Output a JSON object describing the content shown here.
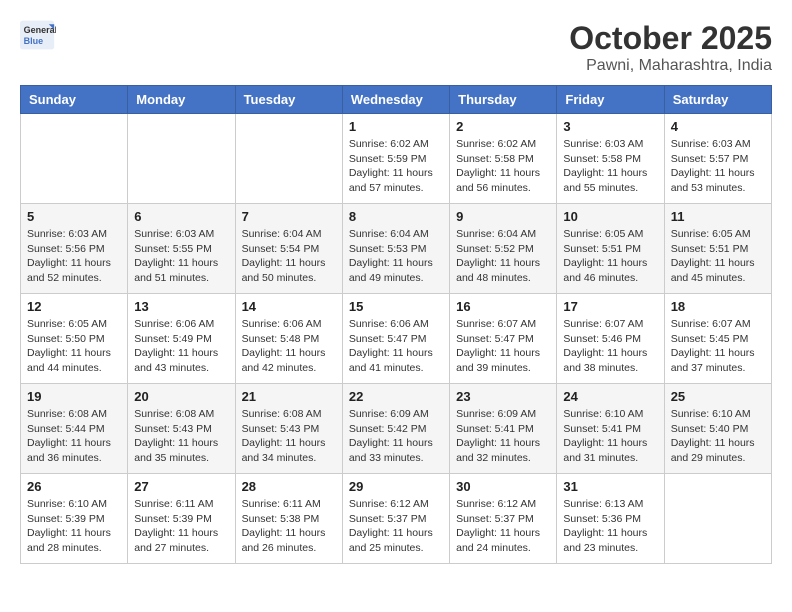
{
  "header": {
    "logo_line1": "General",
    "logo_line2": "Blue",
    "title": "October 2025",
    "subtitle": "Pawni, Maharashtra, India"
  },
  "days_of_week": [
    "Sunday",
    "Monday",
    "Tuesday",
    "Wednesday",
    "Thursday",
    "Friday",
    "Saturday"
  ],
  "weeks": [
    [
      {
        "day": "",
        "info": ""
      },
      {
        "day": "",
        "info": ""
      },
      {
        "day": "",
        "info": ""
      },
      {
        "day": "1",
        "info": "Sunrise: 6:02 AM\nSunset: 5:59 PM\nDaylight: 11 hours\nand 57 minutes."
      },
      {
        "day": "2",
        "info": "Sunrise: 6:02 AM\nSunset: 5:58 PM\nDaylight: 11 hours\nand 56 minutes."
      },
      {
        "day": "3",
        "info": "Sunrise: 6:03 AM\nSunset: 5:58 PM\nDaylight: 11 hours\nand 55 minutes."
      },
      {
        "day": "4",
        "info": "Sunrise: 6:03 AM\nSunset: 5:57 PM\nDaylight: 11 hours\nand 53 minutes."
      }
    ],
    [
      {
        "day": "5",
        "info": "Sunrise: 6:03 AM\nSunset: 5:56 PM\nDaylight: 11 hours\nand 52 minutes."
      },
      {
        "day": "6",
        "info": "Sunrise: 6:03 AM\nSunset: 5:55 PM\nDaylight: 11 hours\nand 51 minutes."
      },
      {
        "day": "7",
        "info": "Sunrise: 6:04 AM\nSunset: 5:54 PM\nDaylight: 11 hours\nand 50 minutes."
      },
      {
        "day": "8",
        "info": "Sunrise: 6:04 AM\nSunset: 5:53 PM\nDaylight: 11 hours\nand 49 minutes."
      },
      {
        "day": "9",
        "info": "Sunrise: 6:04 AM\nSunset: 5:52 PM\nDaylight: 11 hours\nand 48 minutes."
      },
      {
        "day": "10",
        "info": "Sunrise: 6:05 AM\nSunset: 5:51 PM\nDaylight: 11 hours\nand 46 minutes."
      },
      {
        "day": "11",
        "info": "Sunrise: 6:05 AM\nSunset: 5:51 PM\nDaylight: 11 hours\nand 45 minutes."
      }
    ],
    [
      {
        "day": "12",
        "info": "Sunrise: 6:05 AM\nSunset: 5:50 PM\nDaylight: 11 hours\nand 44 minutes."
      },
      {
        "day": "13",
        "info": "Sunrise: 6:06 AM\nSunset: 5:49 PM\nDaylight: 11 hours\nand 43 minutes."
      },
      {
        "day": "14",
        "info": "Sunrise: 6:06 AM\nSunset: 5:48 PM\nDaylight: 11 hours\nand 42 minutes."
      },
      {
        "day": "15",
        "info": "Sunrise: 6:06 AM\nSunset: 5:47 PM\nDaylight: 11 hours\nand 41 minutes."
      },
      {
        "day": "16",
        "info": "Sunrise: 6:07 AM\nSunset: 5:47 PM\nDaylight: 11 hours\nand 39 minutes."
      },
      {
        "day": "17",
        "info": "Sunrise: 6:07 AM\nSunset: 5:46 PM\nDaylight: 11 hours\nand 38 minutes."
      },
      {
        "day": "18",
        "info": "Sunrise: 6:07 AM\nSunset: 5:45 PM\nDaylight: 11 hours\nand 37 minutes."
      }
    ],
    [
      {
        "day": "19",
        "info": "Sunrise: 6:08 AM\nSunset: 5:44 PM\nDaylight: 11 hours\nand 36 minutes."
      },
      {
        "day": "20",
        "info": "Sunrise: 6:08 AM\nSunset: 5:43 PM\nDaylight: 11 hours\nand 35 minutes."
      },
      {
        "day": "21",
        "info": "Sunrise: 6:08 AM\nSunset: 5:43 PM\nDaylight: 11 hours\nand 34 minutes."
      },
      {
        "day": "22",
        "info": "Sunrise: 6:09 AM\nSunset: 5:42 PM\nDaylight: 11 hours\nand 33 minutes."
      },
      {
        "day": "23",
        "info": "Sunrise: 6:09 AM\nSunset: 5:41 PM\nDaylight: 11 hours\nand 32 minutes."
      },
      {
        "day": "24",
        "info": "Sunrise: 6:10 AM\nSunset: 5:41 PM\nDaylight: 11 hours\nand 31 minutes."
      },
      {
        "day": "25",
        "info": "Sunrise: 6:10 AM\nSunset: 5:40 PM\nDaylight: 11 hours\nand 29 minutes."
      }
    ],
    [
      {
        "day": "26",
        "info": "Sunrise: 6:10 AM\nSunset: 5:39 PM\nDaylight: 11 hours\nand 28 minutes."
      },
      {
        "day": "27",
        "info": "Sunrise: 6:11 AM\nSunset: 5:39 PM\nDaylight: 11 hours\nand 27 minutes."
      },
      {
        "day": "28",
        "info": "Sunrise: 6:11 AM\nSunset: 5:38 PM\nDaylight: 11 hours\nand 26 minutes."
      },
      {
        "day": "29",
        "info": "Sunrise: 6:12 AM\nSunset: 5:37 PM\nDaylight: 11 hours\nand 25 minutes."
      },
      {
        "day": "30",
        "info": "Sunrise: 6:12 AM\nSunset: 5:37 PM\nDaylight: 11 hours\nand 24 minutes."
      },
      {
        "day": "31",
        "info": "Sunrise: 6:13 AM\nSunset: 5:36 PM\nDaylight: 11 hours\nand 23 minutes."
      },
      {
        "day": "",
        "info": ""
      }
    ]
  ]
}
